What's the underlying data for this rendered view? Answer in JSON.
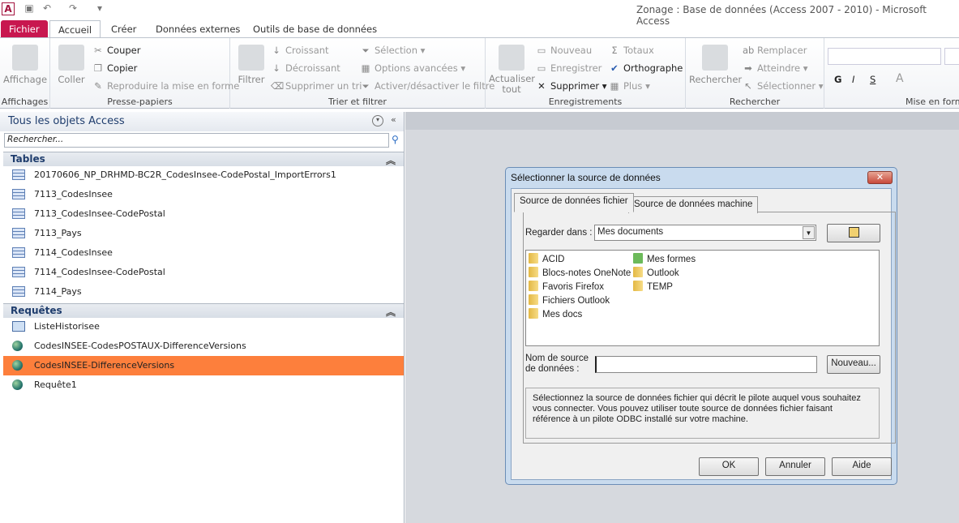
{
  "window": {
    "title": "Zonage : Base de données (Access 2007 - 2010)  -  Microsoft Access"
  },
  "tabs": [
    "Fichier",
    "Accueil",
    "Créer",
    "Données externes",
    "Outils de base de données"
  ],
  "ribbon": {
    "affichages": {
      "label": "Affichages",
      "affichage": "Affichage"
    },
    "presse": {
      "label": "Presse-papiers",
      "coller": "Coller",
      "couper": "Couper",
      "copier": "Copier",
      "reproduire": "Reproduire la mise en forme"
    },
    "trier": {
      "label": "Trier et filtrer",
      "filtrer": "Filtrer",
      "croissant": "Croissant",
      "decroissant": "Décroissant",
      "supprimer_tri": "Supprimer un tri",
      "selection": "Sélection",
      "options": "Options avancées",
      "activer": "Activer/désactiver le filtre"
    },
    "enreg": {
      "label": "Enregistrements",
      "actualiser": "Actualiser",
      "tout": "tout",
      "nouveau": "Nouveau",
      "enregistrer": "Enregistrer",
      "supprimer": "Supprimer",
      "totaux": "Totaux",
      "orthographe": "Orthographe",
      "plus": "Plus"
    },
    "rechercher": {
      "label": "Rechercher",
      "rechercher": "Rechercher",
      "remplacer": "Remplacer",
      "atteindre": "Atteindre",
      "selectionner": "Sélectionner"
    },
    "mise": {
      "label": "Mise en forme",
      "g": "G",
      "i": "I",
      "s": "S",
      "a": "A"
    }
  },
  "nav": {
    "title": "Tous les objets Access",
    "search_placeholder": "Rechercher...",
    "sections": [
      {
        "title": "Tables",
        "items": [
          "20170606_NP_DRHMD-BC2R_CodesInsee-CodePostal_ImportErrors1",
          "7113_CodesInsee",
          "7113_CodesInsee-CodePostal",
          "7113_Pays",
          "7114_CodesInsee",
          "7114_CodesInsee-CodePostal",
          "7114_Pays"
        ]
      },
      {
        "title": "Requêtes",
        "items": [
          "ListeHistorisee",
          "CodesINSEE-CodesPOSTAUX-DifferenceVersions",
          "CodesINSEE-DifferenceVersions",
          "Requête1"
        ]
      }
    ],
    "selected": "CodesINSEE-DifferenceVersions",
    "selected_color": "#fd7f3c"
  },
  "dialog": {
    "title": "Sélectionner la source de données",
    "tabs": [
      "Source de données fichier",
      "Source de données machine"
    ],
    "look_in_label": "Regarder dans :",
    "look_in_value": "Mes documents",
    "files_col1": [
      "ACID",
      "Blocs-notes OneNote",
      "Favoris Firefox",
      "Fichiers Outlook",
      "Mes docs"
    ],
    "files_col2": [
      "Mes formes",
      "Outlook",
      "TEMP"
    ],
    "dsn_label_1": "Nom de source",
    "dsn_label_2": "de données :",
    "dsn_value": "",
    "new_button": "Nouveau...",
    "description": "Sélectionnez la source de données fichier qui décrit le pilote auquel vous souhaitez vous connecter. Vous pouvez utiliser toute source de données fichier faisant référence à un pilote ODBC installé sur votre machine.",
    "ok": "OK",
    "cancel": "Annuler",
    "help": "Aide"
  }
}
